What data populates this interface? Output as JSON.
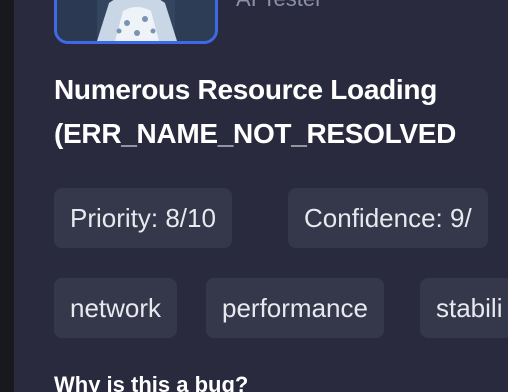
{
  "reporter": {
    "role": "AI Tester"
  },
  "bug": {
    "title_line1": "Numerous Resource Loading",
    "title_line2": "(ERR_NAME_NOT_RESOLVED"
  },
  "meta": {
    "priority": "Priority: 8/10",
    "confidence": "Confidence: 9/"
  },
  "tags": [
    "network",
    "performance",
    "stabili"
  ],
  "section": {
    "why_heading": "Why is this a bug?"
  },
  "colors": {
    "panel_bg": "#292a3d",
    "chip_bg": "#35374a",
    "avatar_border": "#3f6ae6",
    "text_primary": "#ffffff"
  }
}
